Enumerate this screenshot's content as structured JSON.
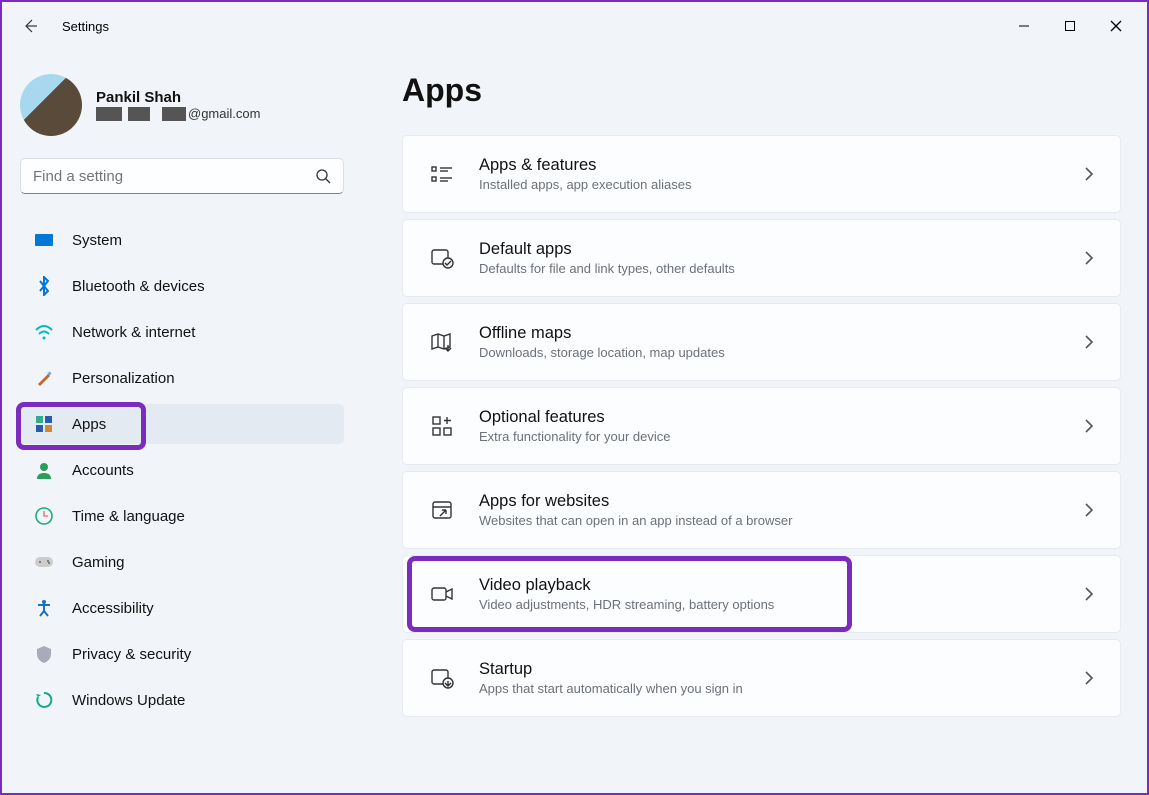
{
  "window_title": "Settings",
  "profile": {
    "name": "Pankil Shah",
    "email_suffix": "@gmail.com"
  },
  "search": {
    "placeholder": "Find a setting"
  },
  "nav": [
    {
      "id": "system",
      "label": "System"
    },
    {
      "id": "bluetooth",
      "label": "Bluetooth & devices"
    },
    {
      "id": "network",
      "label": "Network & internet"
    },
    {
      "id": "personalization",
      "label": "Personalization"
    },
    {
      "id": "apps",
      "label": "Apps",
      "active": true
    },
    {
      "id": "accounts",
      "label": "Accounts"
    },
    {
      "id": "time",
      "label": "Time & language"
    },
    {
      "id": "gaming",
      "label": "Gaming"
    },
    {
      "id": "accessibility",
      "label": "Accessibility"
    },
    {
      "id": "privacy",
      "label": "Privacy & security"
    },
    {
      "id": "update",
      "label": "Windows Update"
    }
  ],
  "page": {
    "title": "Apps"
  },
  "cards": [
    {
      "id": "apps-features",
      "title": "Apps & features",
      "sub": "Installed apps, app execution aliases"
    },
    {
      "id": "default-apps",
      "title": "Default apps",
      "sub": "Defaults for file and link types, other defaults"
    },
    {
      "id": "offline-maps",
      "title": "Offline maps",
      "sub": "Downloads, storage location, map updates"
    },
    {
      "id": "optional-features",
      "title": "Optional features",
      "sub": "Extra functionality for your device"
    },
    {
      "id": "apps-websites",
      "title": "Apps for websites",
      "sub": "Websites that can open in an app instead of a browser"
    },
    {
      "id": "video-playback",
      "title": "Video playback",
      "sub": "Video adjustments, HDR streaming, battery options",
      "highlighted": true
    },
    {
      "id": "startup",
      "title": "Startup",
      "sub": "Apps that start automatically when you sign in"
    }
  ]
}
